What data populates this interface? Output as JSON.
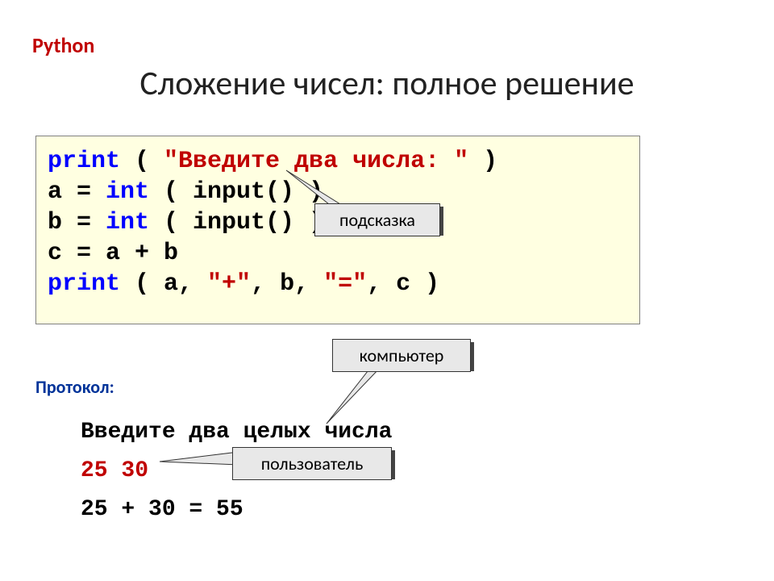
{
  "header": {
    "language": "Python",
    "title": "Сложение чисел: полное решение"
  },
  "code": {
    "l1_kw": "print",
    "l1_paren_open": " ( ",
    "l1_str": "\"Введите два числа: \"",
    "l1_paren_close": " )",
    "l2_a": "a = ",
    "l2_int": "int",
    "l2_rest": " ( input() )",
    "l3_b": "b = ",
    "l3_int": "int",
    "l3_rest": " ( input() )",
    "l4": "c = a + b",
    "l5_kw": "print",
    "l5_open": " ( a, ",
    "l5_s1": "\"+\"",
    "l5_mid": ", b, ",
    "l5_s2": "\"=\"",
    "l5_close": ", c )"
  },
  "callouts": {
    "hint": "подсказка",
    "computer": "компьютер",
    "user": "пользователь"
  },
  "protocol": {
    "label": "Протокол:",
    "line1": "Введите два целых числа",
    "line2": "25 30",
    "line3": "25 + 30 = 55"
  }
}
